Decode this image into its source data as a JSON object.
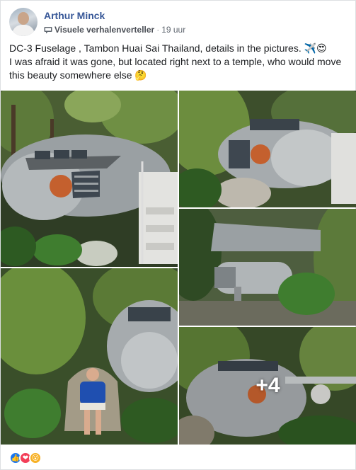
{
  "post": {
    "author": "Arthur Minck",
    "badge": "Visuele verhalenverteller",
    "separator": "·",
    "time": "19 uur",
    "caption_line1": "DC-3 Fuselage , Tambon Huai Sai Thailand, details in the pictures. ✈️😍",
    "caption_line2": "I was afraid it was gone, but located right next to a temple, who would move this beauty somewhere else 🤔"
  },
  "photos": {
    "count": 5,
    "more_label": "+4"
  },
  "reactions": {
    "icons": [
      "like-icon",
      "love-icon",
      "wow-icon"
    ],
    "like_glyph": "👍",
    "love_glyph": "❤",
    "wow_glyph": "😮"
  },
  "colors": {
    "author_link": "#385898",
    "meta_text": "#606770",
    "like": "#1877f2",
    "love": "#f33e58",
    "wow": "#f7b125"
  }
}
